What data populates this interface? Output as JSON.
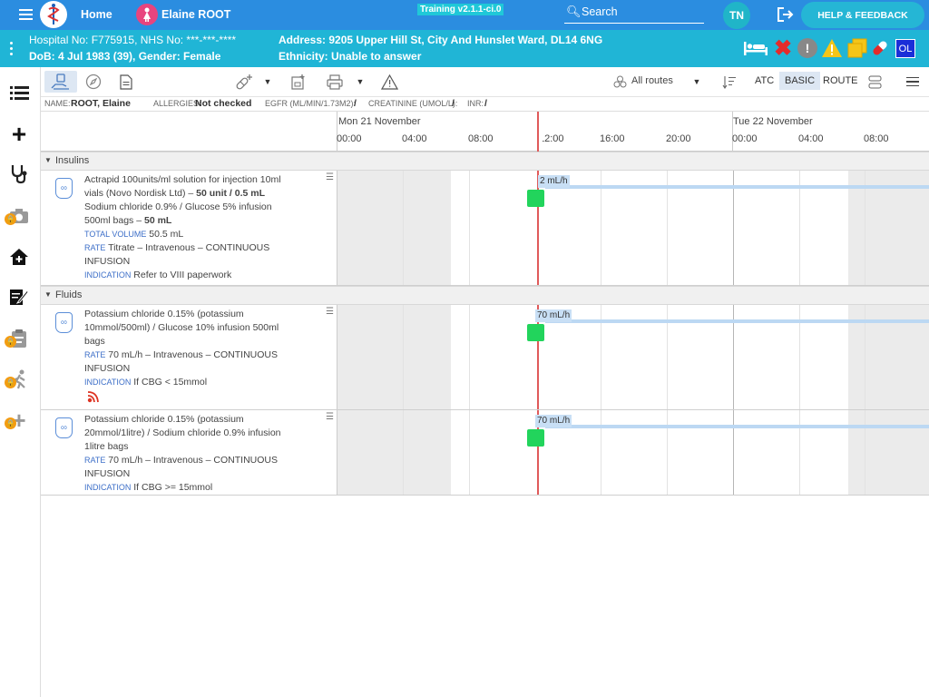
{
  "topbar": {
    "home": "Home",
    "patient_name": "Elaine ROOT",
    "training": "Training v2.1.1-ci.0",
    "search_placeholder": "Search",
    "user_initials": "TN",
    "help": "HELP & FEEDBACK"
  },
  "patient": {
    "hospital_line": "Hospital No: F775915, NHS No: ***-***-****",
    "dob_line": "DoB: 4 Jul 1983 (39), Gender: Female",
    "address": "Address: 9205 Upper Hill St, City And Hunslet Ward, DL14 6NG",
    "ethnicity": "Ethnicity: Unable to answer",
    "badge": "OL"
  },
  "toolbar": {
    "routes": "All routes",
    "atc": "ATC",
    "basic": "BASIC",
    "route": "ROUTE"
  },
  "info": {
    "name_label": "NAME:",
    "name": "ROOT, Elaine",
    "allergies_label": "ALLERGIES:",
    "allergies": "Not checked",
    "egfr_label": "EGFR (ML/MIN/1.73M2):",
    "egfr": "/",
    "creat_label": "CREATININE (UMOL/L):",
    "creat": "/",
    "inr_label": "INR:",
    "inr": "/"
  },
  "timeline": {
    "day1": "Mon 21 November",
    "day2": "Tue 22 November",
    "ticks": [
      "00:00",
      "04:00",
      "08:00",
      "12:00",
      "16:00",
      "20:00",
      "00:00",
      "04:00",
      "08:00"
    ]
  },
  "sections": [
    {
      "name": "Insulins"
    },
    {
      "name": "Fluids"
    }
  ],
  "orders": [
    {
      "drug": "Actrapid 100units/ml solution for injection 10ml vials (Novo Nordisk Ltd)",
      "dose": "50 unit / 0.5 mL",
      "drug2": "Sodium chloride 0.9% / Glucose 5% infusion 500ml bags",
      "dose2": "50 mL",
      "total_label": "TOTAL VOLUME",
      "total": "50.5 mL",
      "rate_label": "RATE",
      "rate": "Titrate – Intravenous – CONTINUOUS INFUSION",
      "ind_label": "INDICATION",
      "indication": "Refer to VIII paperwork",
      "bar_rate": "2 mL/h"
    },
    {
      "drug": "Potassium chloride 0.15% (potassium 10mmol/500ml) / Glucose 10% infusion 500ml bags",
      "rate_label": "RATE",
      "rate": "70 mL/h – Intravenous – CONTINUOUS INFUSION",
      "ind_label": "INDICATION",
      "indication": "If CBG < 15mmol",
      "bar_rate": "70 mL/h"
    },
    {
      "drug": "Potassium chloride 0.15% (potassium 20mmol/1litre) / Sodium chloride 0.9% infusion 1litre bags",
      "rate_label": "RATE",
      "rate": "70 mL/h – Intravenous – CONTINUOUS INFUSION",
      "ind_label": "INDICATION",
      "indication": "If CBG >= 15mmol",
      "bar_rate": "70 mL/h"
    }
  ],
  "colors": {
    "topbar": "#2b8de0",
    "patient_bar": "#20b5d6",
    "start_marker": "#22d45c",
    "now_line": "#e05a5a",
    "lock": "#f39c12"
  }
}
